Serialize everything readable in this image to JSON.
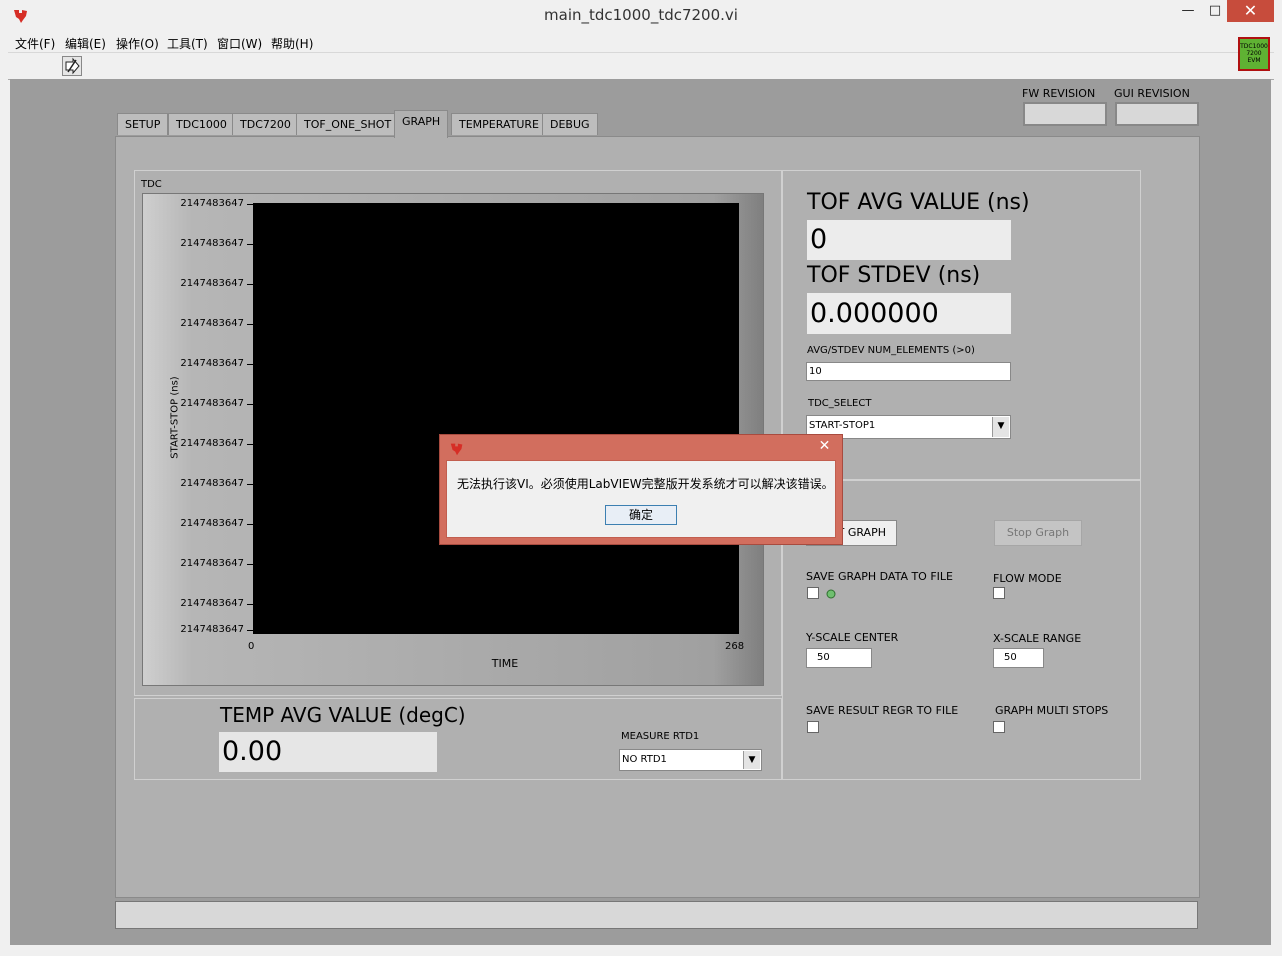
{
  "window": {
    "title": "main_tdc1000_tdc7200.vi",
    "min_glyph": "—",
    "max_glyph": "□",
    "close_glyph": "✕"
  },
  "menu": [
    "文件(F)",
    "编辑(E)",
    "操作(O)",
    "工具(T)",
    "窗口(W)",
    "帮助(H)"
  ],
  "evm_logo": {
    "line1": "TDC1000",
    "line2": "7200",
    "line3": "EVM"
  },
  "revisions": {
    "fw_label": "FW REVISION",
    "gui_label": "GUI REVISION"
  },
  "tabs": [
    "SETUP",
    "TDC1000",
    "TDC7200",
    "TOF_ONE_SHOT",
    "GRAPH",
    "TEMPERATURE",
    "DEBUG"
  ],
  "active_tab": "GRAPH",
  "graph": {
    "label": "TDC",
    "y_axis_title": "START-STOP (ns)",
    "x_axis_title": "TIME",
    "y_ticks": [
      "2147483647",
      "2147483647",
      "2147483647",
      "2147483647",
      "2147483647",
      "2147483647",
      "2147483647",
      "2147483647",
      "2147483647",
      "2147483647",
      "2147483647",
      "2147483647"
    ],
    "x_min": "0",
    "x_max": "268",
    "plot_background": "#000000"
  },
  "temp": {
    "label": "TEMP AVG VALUE (degC)",
    "value": "0.00",
    "rtd_label": "MEASURE RTD1",
    "rtd_selected": "NO RTD1"
  },
  "tof": {
    "avg_label": "TOF AVG VALUE (ns)",
    "avg_value": "0",
    "stdev_label": "TOF STDEV (ns)",
    "stdev_value": "0.000000",
    "num_elements_label": "AVG/STDEV NUM_ELEMENTS (>0)",
    "num_elements_value": "10",
    "tdc_select_label": "TDC_SELECT",
    "tdc_select_value": "START-STOP1"
  },
  "controls": {
    "start_graph": "T GRAPH",
    "stop_graph": "Stop Graph",
    "save_graph_label": "SAVE GRAPH DATA TO FILE",
    "flow_mode_label": "FLOW MODE",
    "y_scale_label": "Y-SCALE CENTER",
    "y_scale_value": "50",
    "x_scale_label": "X-SCALE RANGE",
    "x_scale_value": "50",
    "save_result_label": "SAVE RESULT REGR TO FILE",
    "graph_multi_label": "GRAPH MULTI STOPS"
  },
  "dialog": {
    "message": "无法执行该VI。必须使用LabVIEW完整版开发系统才可以解决该错误。",
    "ok_label": "确定",
    "close_glyph": "✕"
  },
  "colors": {
    "accent_red": "#d62e26",
    "dialog_frame": "#d26e5e",
    "panel_gray": "#9c9c9c"
  }
}
